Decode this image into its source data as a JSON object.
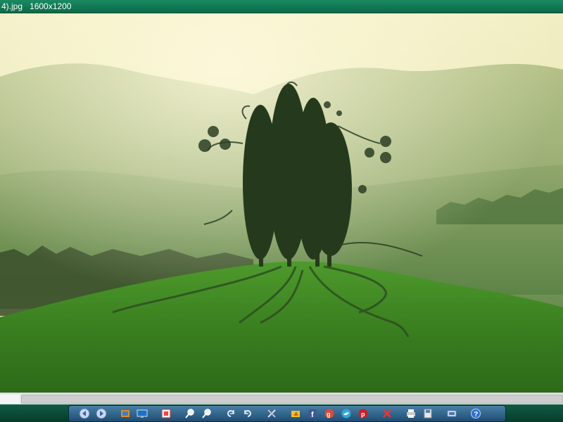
{
  "window": {
    "title": "4).jpg   1600x1200"
  },
  "colors": {
    "titlebar": "#0a6a48",
    "toolbar": "#2a5a80",
    "sky": "#f3f0c8",
    "grass": "#3f8a24"
  },
  "toolbar": {
    "buttons": [
      {
        "name": "previous-image-button",
        "icon": "back-arrow-icon"
      },
      {
        "name": "next-image-button",
        "icon": "forward-arrow-icon"
      },
      {
        "name": "open-folder-button",
        "icon": "folder-image-icon"
      },
      {
        "name": "slideshow-button",
        "icon": "monitor-icon"
      },
      {
        "name": "fit-to-screen-button",
        "icon": "fit-frame-icon"
      },
      {
        "name": "zoom-in-button",
        "icon": "zoom-in-icon"
      },
      {
        "name": "zoom-out-button",
        "icon": "zoom-out-icon"
      },
      {
        "name": "rotate-left-button",
        "icon": "rotate-left-icon"
      },
      {
        "name": "rotate-right-button",
        "icon": "rotate-right-icon"
      },
      {
        "name": "tools-button",
        "icon": "tools-icon"
      },
      {
        "name": "edit-image-button",
        "icon": "paint-icon"
      },
      {
        "name": "share-facebook-button",
        "icon": "facebook-icon"
      },
      {
        "name": "share-google-button",
        "icon": "google-plus-icon"
      },
      {
        "name": "share-twitter-button",
        "icon": "twitter-icon"
      },
      {
        "name": "share-pinterest-button",
        "icon": "pinterest-icon"
      },
      {
        "name": "delete-button",
        "icon": "delete-icon"
      },
      {
        "name": "print-button",
        "icon": "print-icon"
      },
      {
        "name": "save-button",
        "icon": "save-icon"
      },
      {
        "name": "settings-button",
        "icon": "settings-icon"
      },
      {
        "name": "help-button",
        "icon": "help-icon"
      }
    ]
  }
}
